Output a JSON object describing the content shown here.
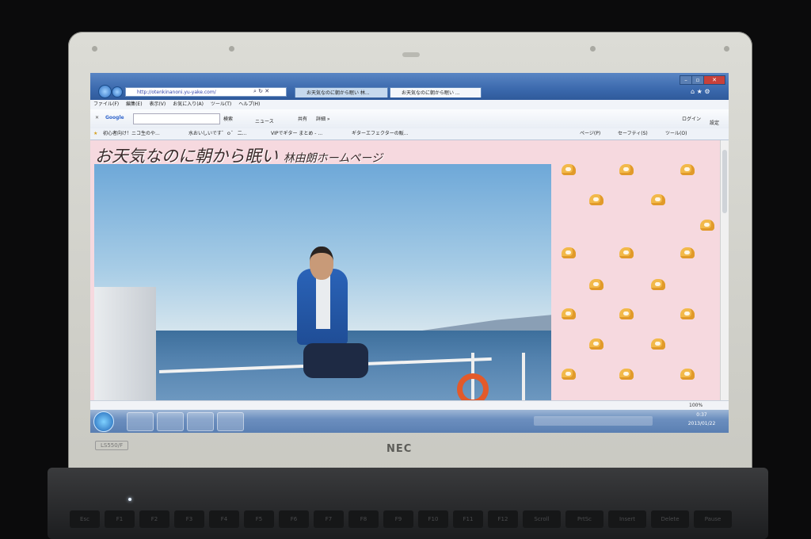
{
  "browser": {
    "address": "http://otenkinanoni.yu-yake.com/",
    "tabs": [
      {
        "label": "お天気なのに朝から眠い 林..."
      },
      {
        "label": "お天気なのに朝から眠い ..."
      }
    ],
    "window_buttons": {
      "minimize": "–",
      "maximize": "▫",
      "close": "✕"
    },
    "menu": [
      "ファイル(F)",
      "編集(E)",
      "表示(V)",
      "お気に入り(A)",
      "ツール(T)",
      "ヘルプ(H)"
    ],
    "google_label": "Google",
    "google_search": "検索",
    "news": "ニュース",
    "share": "共有",
    "more": "詳細 »",
    "login": "ログイン",
    "settings": "設定",
    "favorites": [
      "初心者向け！ニコ生のや...",
      "水おいしいです゛ｏ゛ 二...",
      "VIPでギター まとめ - ...",
      "ギターエフェクターの販..."
    ],
    "command": [
      "ページ(P)",
      "セーフティ(S)",
      "ツール(O)"
    ],
    "zoom": "100%"
  },
  "page": {
    "title": "お天気なのに朝から眠い",
    "subtitle": "林由朗ホームページ"
  },
  "taskbar": {
    "time": "0:37",
    "date": "2013/01/22"
  },
  "laptop": {
    "brand": "NEC",
    "model": "LS550/F"
  }
}
